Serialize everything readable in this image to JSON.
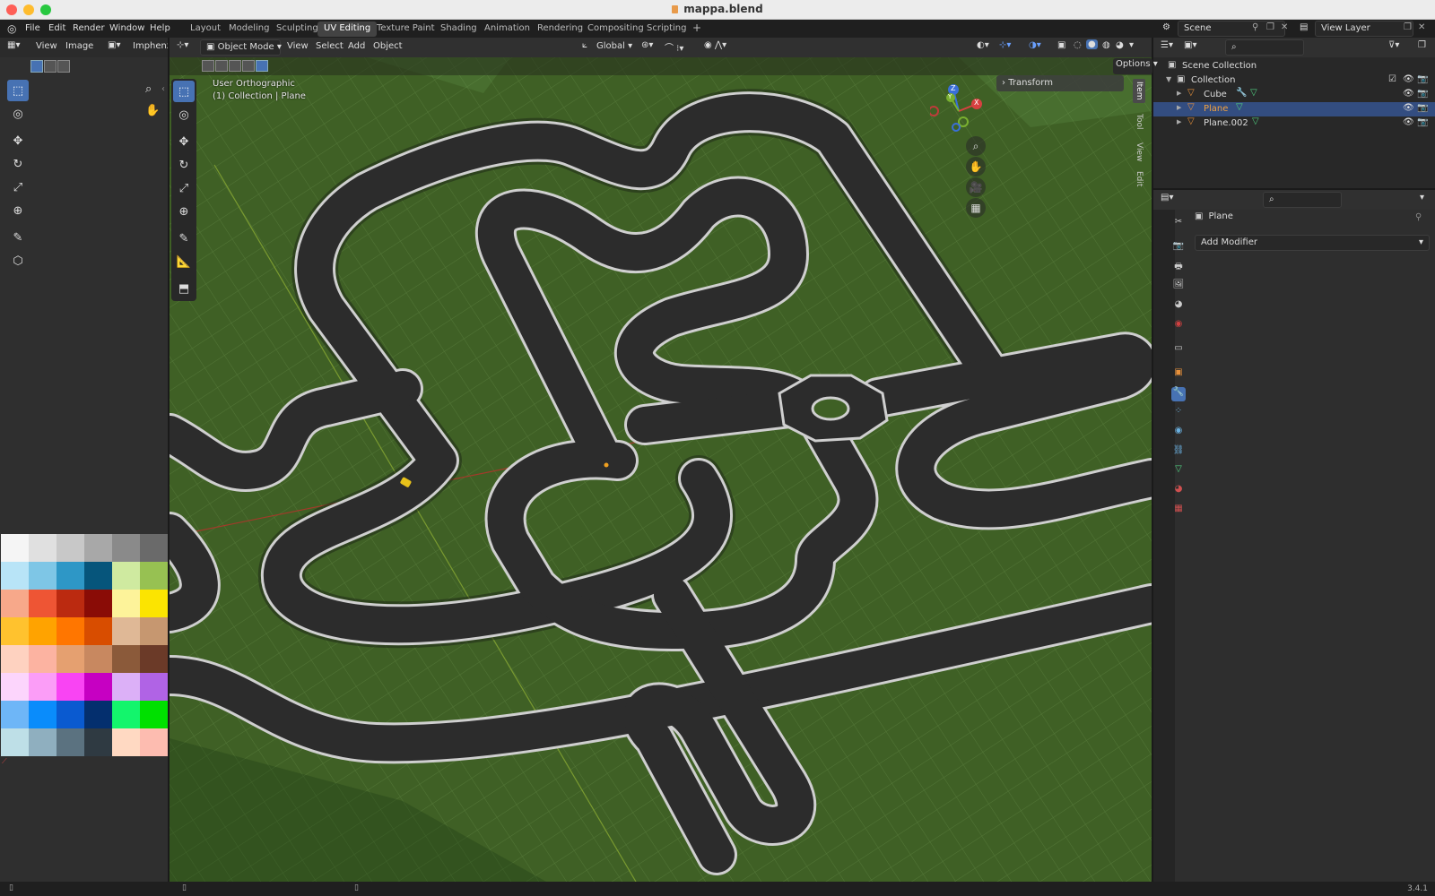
{
  "window": {
    "title": "mappa.blend"
  },
  "menu": [
    "File",
    "Edit",
    "Render",
    "Window",
    "Help"
  ],
  "workspaces": [
    {
      "label": "Layout",
      "active": false
    },
    {
      "label": "Modeling",
      "active": false
    },
    {
      "label": "Sculpting",
      "active": false
    },
    {
      "label": "UV Editing",
      "active": true
    },
    {
      "label": "Texture Paint",
      "active": false
    },
    {
      "label": "Shading",
      "active": false
    },
    {
      "label": "Animation",
      "active": false
    },
    {
      "label": "Rendering",
      "active": false
    },
    {
      "label": "Compositing",
      "active": false
    },
    {
      "label": "Scripting",
      "active": false
    }
  ],
  "scene": {
    "label": "Scene",
    "view_layer": "View Layer"
  },
  "uv_editor": {
    "view": "View",
    "image": "Image",
    "image_name": "Imphenzi"
  },
  "viewport": {
    "mode": "Object Mode",
    "menus": [
      "View",
      "Select",
      "Add",
      "Object"
    ],
    "orientation": "Global",
    "options": "Options",
    "info_line1": "User Orthographic",
    "info_line2": "(1) Collection | Plane",
    "transform_panel": "Transform",
    "side_tabs": [
      "Item",
      "Tool",
      "View",
      "Edit"
    ],
    "gizmo": {
      "x": "X",
      "y": "Y",
      "z": "Z"
    }
  },
  "outliner": {
    "root": "Scene Collection",
    "collection": "Collection",
    "items": [
      {
        "name": "Cube",
        "selected": false
      },
      {
        "name": "Plane",
        "selected": true
      },
      {
        "name": "Plane.002",
        "selected": false
      }
    ]
  },
  "properties": {
    "object_name": "Plane",
    "add_modifier": "Add Modifier"
  },
  "status": {
    "version": "3.4.1"
  },
  "palette": [
    "#f5f5f5",
    "#e0e0e0",
    "#c8c8c8",
    "#a8a8a8",
    "#8a8a8a",
    "#6a6a6a",
    "#b8e4f7",
    "#7ec6e6",
    "#2e97c6",
    "#06557b",
    "#cfeaa0",
    "#97c152",
    "#f7a88a",
    "#ee5534",
    "#bb2a10",
    "#8a0c06",
    "#fdf39a",
    "#fbe401",
    "#ffc22e",
    "#ffa300",
    "#ff7600",
    "#d84d00",
    "#dfb896",
    "#c69770",
    "#fed2c0",
    "#fcb3a1",
    "#e5a070",
    "#c88860",
    "#8b5a3a",
    "#6b3a28",
    "#fcd5fc",
    "#fb9df7",
    "#f944f3",
    "#c600c2",
    "#dcb0f7",
    "#b063e5",
    "#6eb6f7",
    "#0a8cfb",
    "#0a5ad0",
    "#042f6e",
    "#13f56c",
    "#00e000",
    "#bedfe7",
    "#8fafbf",
    "#5b7280",
    "#2f3a42",
    "#ffd9c2",
    "#fdbcb0"
  ],
  "colors": {
    "accent": "#4772b3",
    "viewport_ground": "#3b5b22"
  }
}
